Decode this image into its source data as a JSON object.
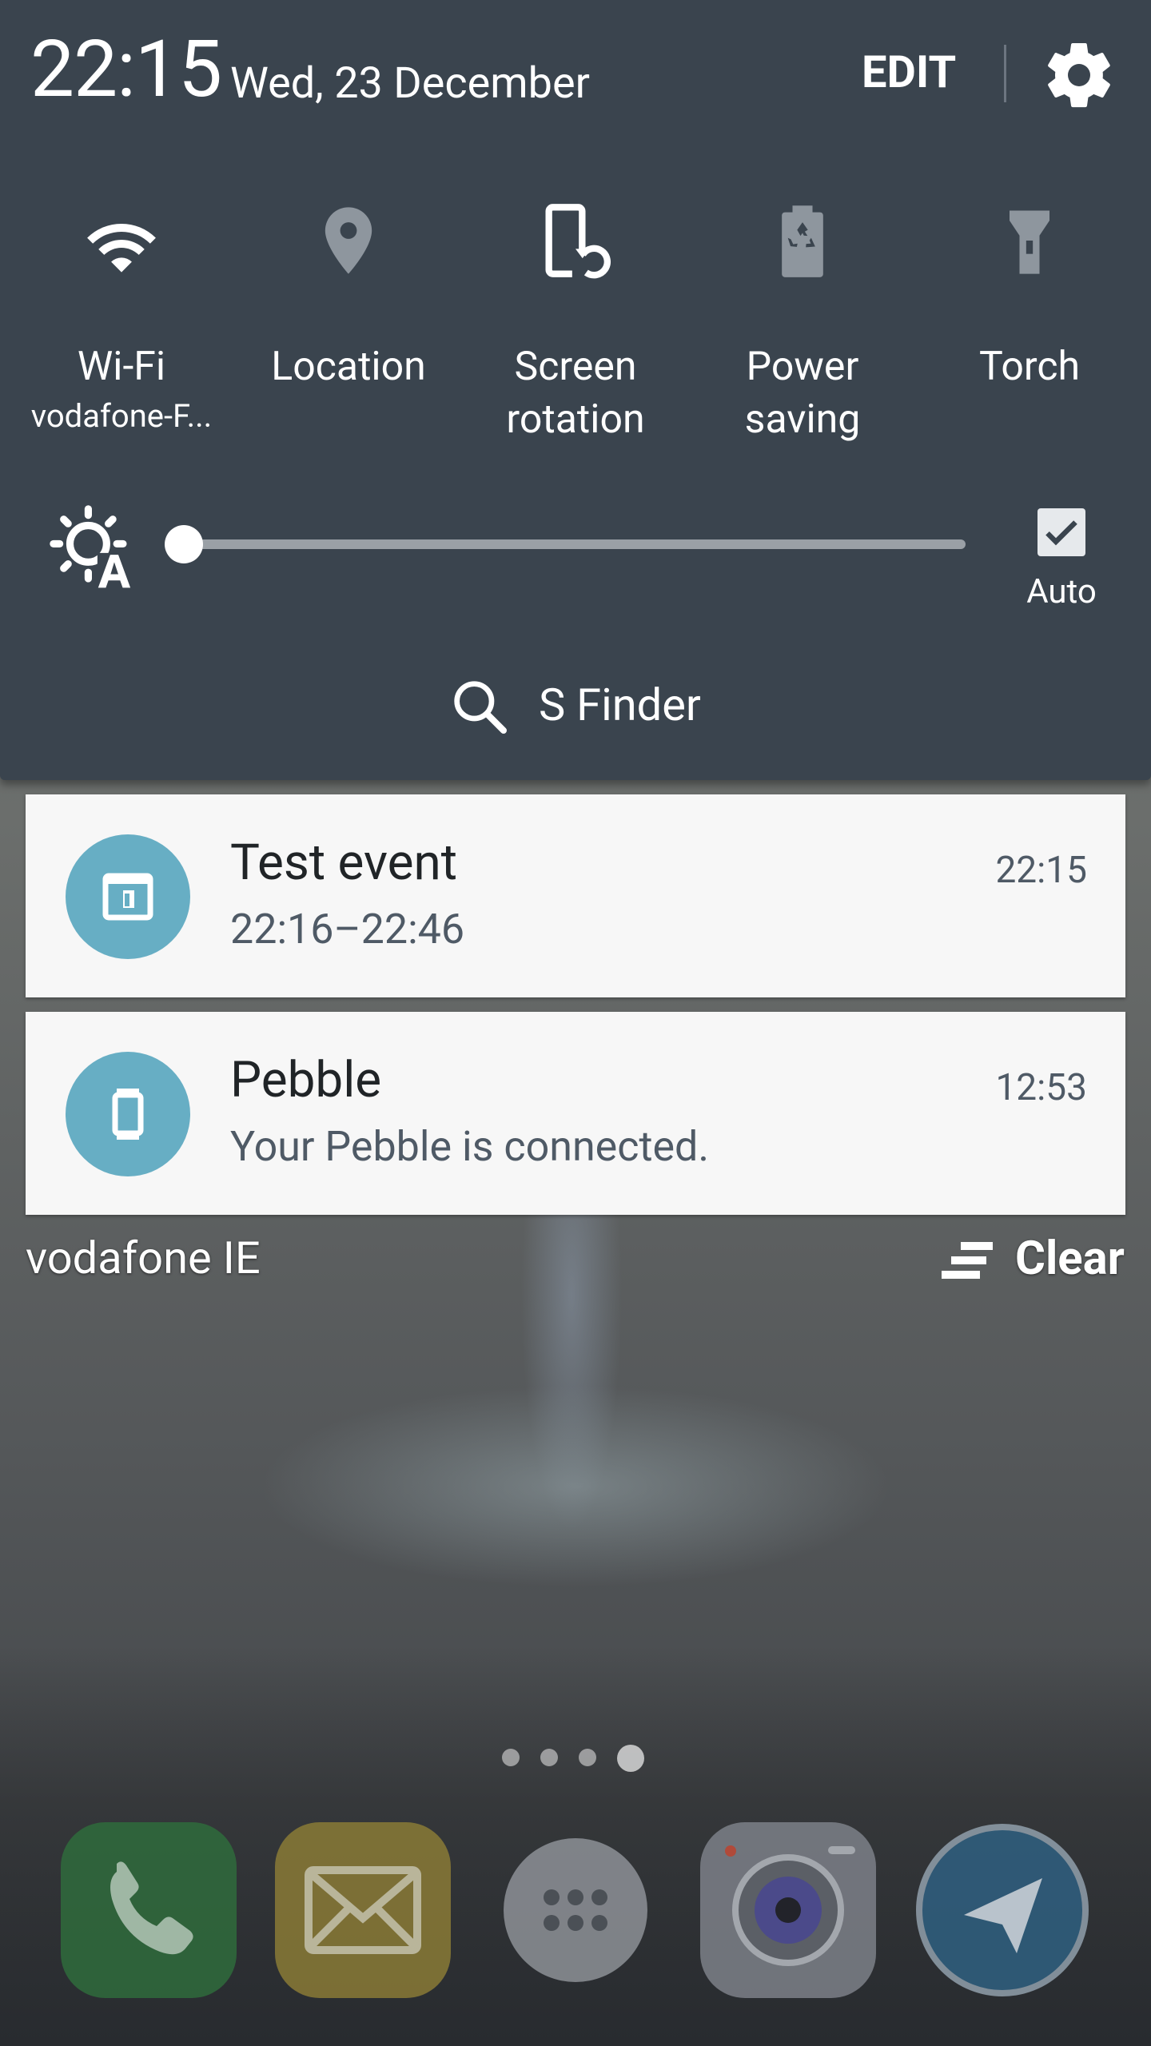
{
  "status": {
    "clock": "22:15",
    "date": "Wed, 23 December",
    "edit_label": "EDIT"
  },
  "quick_settings": [
    {
      "label": "Wi-Fi",
      "sub": "vodafone-F...",
      "icon": "wifi-icon",
      "active": true
    },
    {
      "label": "Location",
      "sub": "",
      "icon": "location-icon",
      "active": false
    },
    {
      "label": "Screen rotation",
      "line1": "Screen",
      "line2": "rotation",
      "icon": "screen-rotation-icon",
      "active": true
    },
    {
      "label": "Power saving",
      "line1": "Power",
      "line2": "saving",
      "icon": "power-saving-icon",
      "active": false
    },
    {
      "label": "Torch",
      "sub": "",
      "icon": "torch-icon",
      "active": false
    }
  ],
  "brightness": {
    "level": 0.0,
    "auto_label": "Auto",
    "auto_checked": true
  },
  "s_finder": {
    "label": "S Finder"
  },
  "notifications": [
    {
      "title": "Test event",
      "body": "22:16–22:46",
      "time": "22:15",
      "icon": "calendar-icon"
    },
    {
      "title": "Pebble",
      "body": "Your Pebble is connected.",
      "time": "12:53",
      "icon": "watch-icon"
    }
  ],
  "carrier": "vodafone IE",
  "clear_label": "Clear",
  "home": {
    "pages": 4,
    "current_page": 4,
    "dock": [
      "phone-icon",
      "messages-icon",
      "apps-icon",
      "camera-icon",
      "telegram-icon"
    ]
  },
  "colors": {
    "panel_bg": "#3a444e",
    "notif_bg": "#f7f7f7",
    "avatar_bg": "#67aec4"
  }
}
